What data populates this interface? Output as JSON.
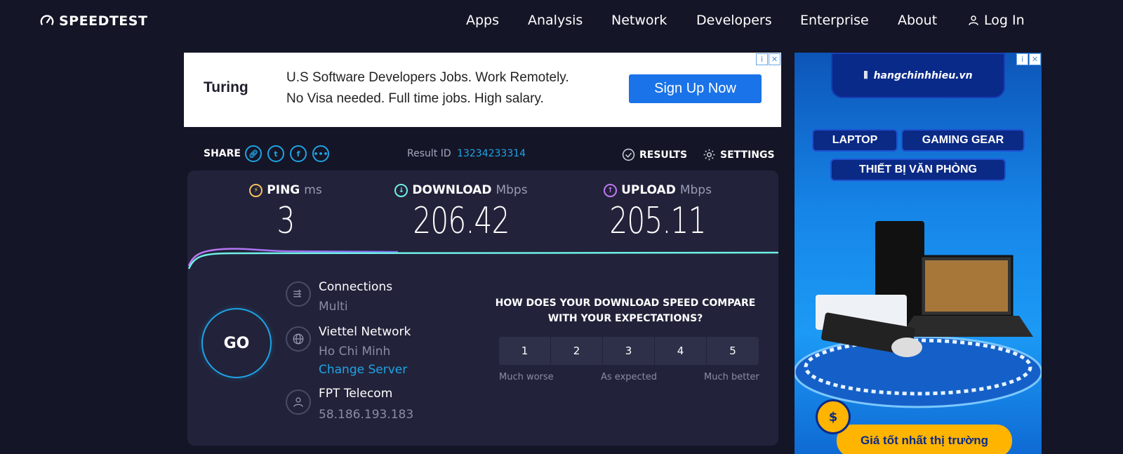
{
  "header": {
    "logo_text": "SPEEDTEST",
    "nav": [
      "Apps",
      "Analysis",
      "Network",
      "Developers",
      "Enterprise",
      "About"
    ],
    "login": "Log In"
  },
  "ad_top": {
    "brand": "Turing",
    "line1": "U.S Software Developers Jobs. Work Remotely.",
    "line2": "No Visa needed. Full time jobs. High salary.",
    "cta": "Sign Up Now"
  },
  "share": {
    "label": "SHARE",
    "result_id_label": "Result ID",
    "result_id": "13234233314",
    "results_label": "RESULTS",
    "settings_label": "SETTINGS"
  },
  "metrics": {
    "ping": {
      "label": "PING",
      "unit": "ms",
      "value": "3",
      "color": "#f4c15d"
    },
    "download": {
      "label": "DOWNLOAD",
      "unit": "Mbps",
      "value": "206.42",
      "color": "#6ff0e6"
    },
    "upload": {
      "label": "UPLOAD",
      "unit": "Mbps",
      "value": "205.11",
      "color": "#c277f4"
    }
  },
  "go_label": "GO",
  "connections": {
    "title": "Connections",
    "value": "Multi"
  },
  "server": {
    "title": "Viettel Network",
    "location": "Ho Chi Minh",
    "change_link": "Change Server"
  },
  "isp": {
    "title": "FPT Telecom",
    "ip": "58.186.193.183"
  },
  "survey": {
    "question": "HOW DOES YOUR DOWNLOAD SPEED COMPARE WITH YOUR EXPECTATIONS?",
    "options": [
      "1",
      "2",
      "3",
      "4",
      "5"
    ],
    "low_label": "Much worse",
    "mid_label": "As expected",
    "high_label": "Much better"
  },
  "ad_side": {
    "site": "hangchinhhieu.vn",
    "pill1": "LAPTOP",
    "pill2": "GAMING GEAR",
    "pill3": "THIẾT BỊ VĂN PHÒNG",
    "promo": "Giá tốt nhất thị trường"
  },
  "colors": {
    "background": "#141526",
    "panel": "#22233a",
    "accent": "#1fa3e6"
  }
}
